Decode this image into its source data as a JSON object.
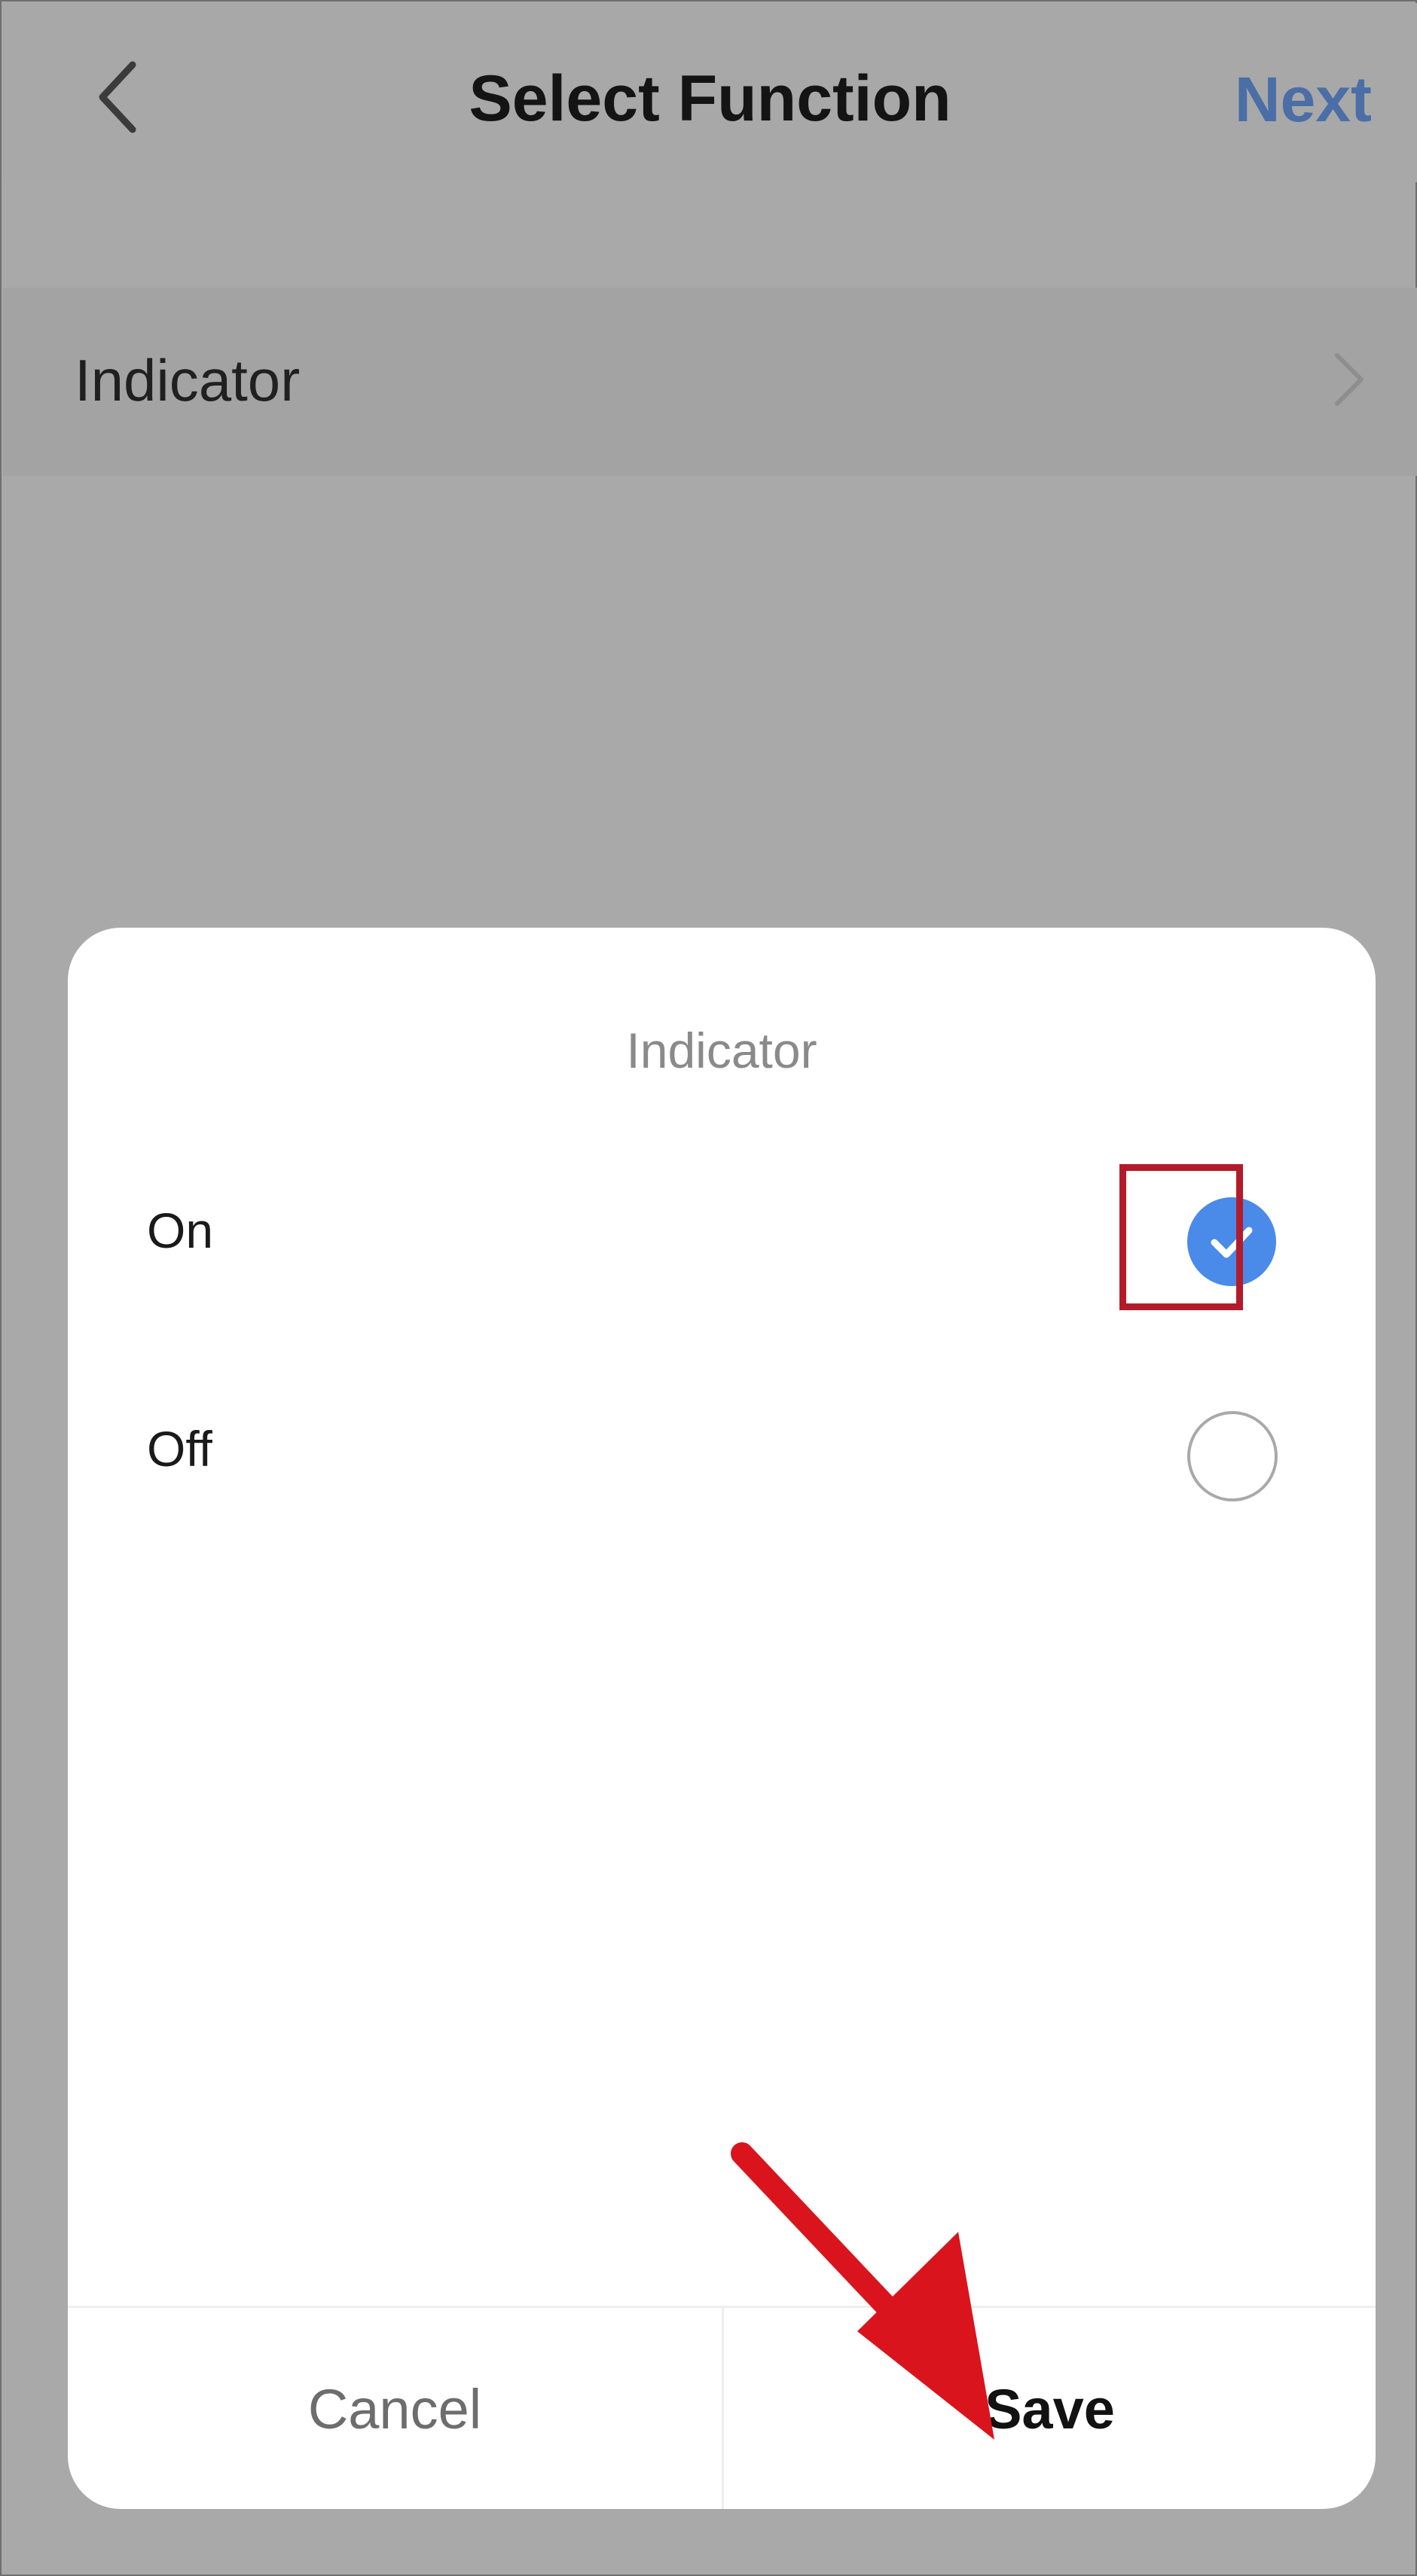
{
  "header": {
    "back_icon": "chevron-left-icon",
    "title": "Select Function",
    "next_label": "Next"
  },
  "menu": {
    "item_label": "Indicator",
    "item_icon": "chevron-right-icon"
  },
  "dialog": {
    "title": "Indicator",
    "options": [
      {
        "label": "On",
        "selected": true
      },
      {
        "label": "Off",
        "selected": false
      }
    ],
    "cancel_label": "Cancel",
    "save_label": "Save"
  },
  "colors": {
    "overlay": "#a9a9a9",
    "accent": "#4b6ea6",
    "radio_selected": "#4a8ae8",
    "highlight": "#b31b2a",
    "arrow": "#d9141d"
  }
}
